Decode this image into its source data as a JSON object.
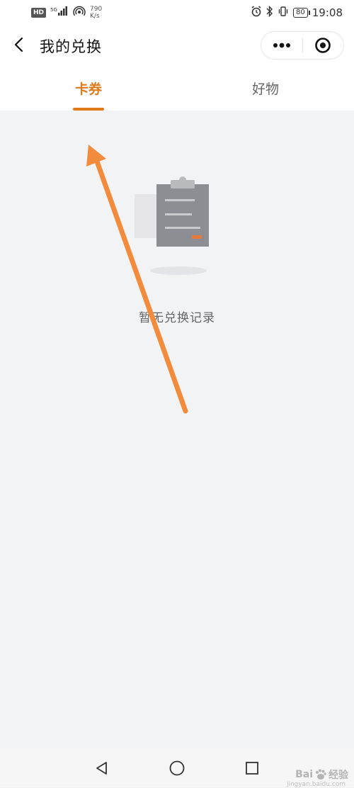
{
  "status_bar": {
    "hd": "HD",
    "net": "5G",
    "speed_value": "790",
    "speed_unit": "K/s",
    "battery": "80",
    "time": "19:08"
  },
  "header": {
    "title": "我的兑换"
  },
  "tabs": [
    {
      "label": "卡券",
      "active": true
    },
    {
      "label": "好物",
      "active": false
    }
  ],
  "empty_state": {
    "message": "暂无兑换记录"
  },
  "colors": {
    "accent": "#e07b1c",
    "arrow": "#f28c3c",
    "background": "#f2f3f5"
  },
  "watermark": {
    "brand": "Bai",
    "suffix": "经验",
    "sub": "jingyan.baidu.com"
  }
}
